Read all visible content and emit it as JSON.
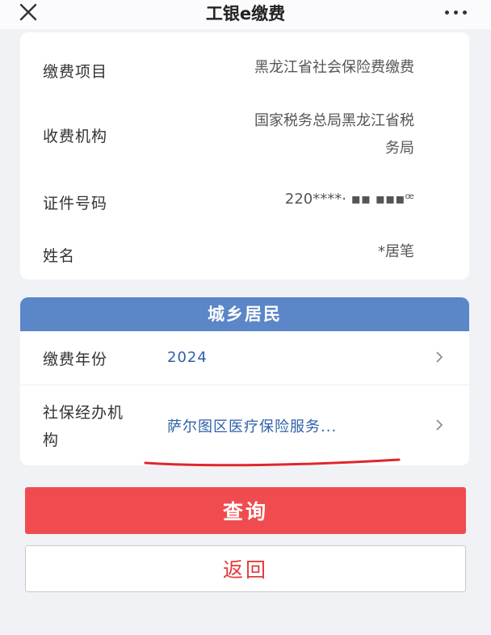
{
  "nav": {
    "title": "工银e缴费",
    "close_icon": "close-icon",
    "more_icon": "more-icon"
  },
  "payment_info": {
    "item_label": "缴费项目",
    "item_value": "黑龙江省社会保险费缴费",
    "agency_label": "收费机构",
    "agency_value_line1": "国家税务总局黑龙江省税",
    "agency_value_line2": "务局",
    "id_label": "证件号码",
    "id_value": "220****·  ▪▪  ▪▪▪ꟹ",
    "name_label": "姓名",
    "name_value": "*居笔"
  },
  "resident": {
    "header": "城乡居民",
    "year_label": "缴费年份",
    "year_value": "2024",
    "office_label_line1": "社保经办机",
    "office_label_line2": "构",
    "office_value": "萨尔图区医疗保险服务...",
    "chevron_icon": "chevron-right-icon"
  },
  "actions": {
    "query_label": "查询",
    "back_label": "返回"
  },
  "colors": {
    "header_blue": "#5b86c8",
    "value_blue": "#2f5fa8",
    "query_red": "#f04c4f",
    "annotation_red": "#e0262b"
  }
}
